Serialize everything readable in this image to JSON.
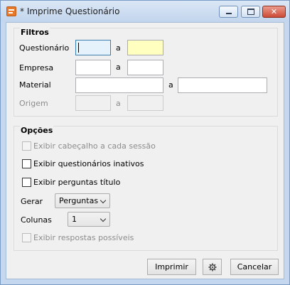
{
  "window": {
    "title": "* Imprime Questionário"
  },
  "filtros": {
    "legend": "Filtros",
    "questionario_label": "Questionário",
    "empresa_label": "Empresa",
    "material_label": "Material",
    "origem_label": "Origem",
    "range_sep": "a",
    "questionario_from": "",
    "questionario_to": "",
    "empresa_from": "",
    "empresa_to": "",
    "material_from": "",
    "material_to": "",
    "origem_from": "",
    "origem_to": ""
  },
  "opcoes": {
    "legend": "Opções",
    "exibir_cabecalho": "Exibir cabeçalho a cada sessão",
    "exibir_inativos": "Exibir questionários inativos",
    "exibir_perguntas_titulo": "Exibir perguntas título",
    "gerar_label": "Gerar",
    "gerar_value": "Perguntas",
    "colunas_label": "Colunas",
    "colunas_value": "1",
    "exibir_respostas": "Exibir respostas possíveis"
  },
  "buttons": {
    "imprimir": "Imprimir",
    "cancelar": "Cancelar"
  },
  "icons": {
    "app": "form-icon",
    "settings": "gear-icon"
  }
}
